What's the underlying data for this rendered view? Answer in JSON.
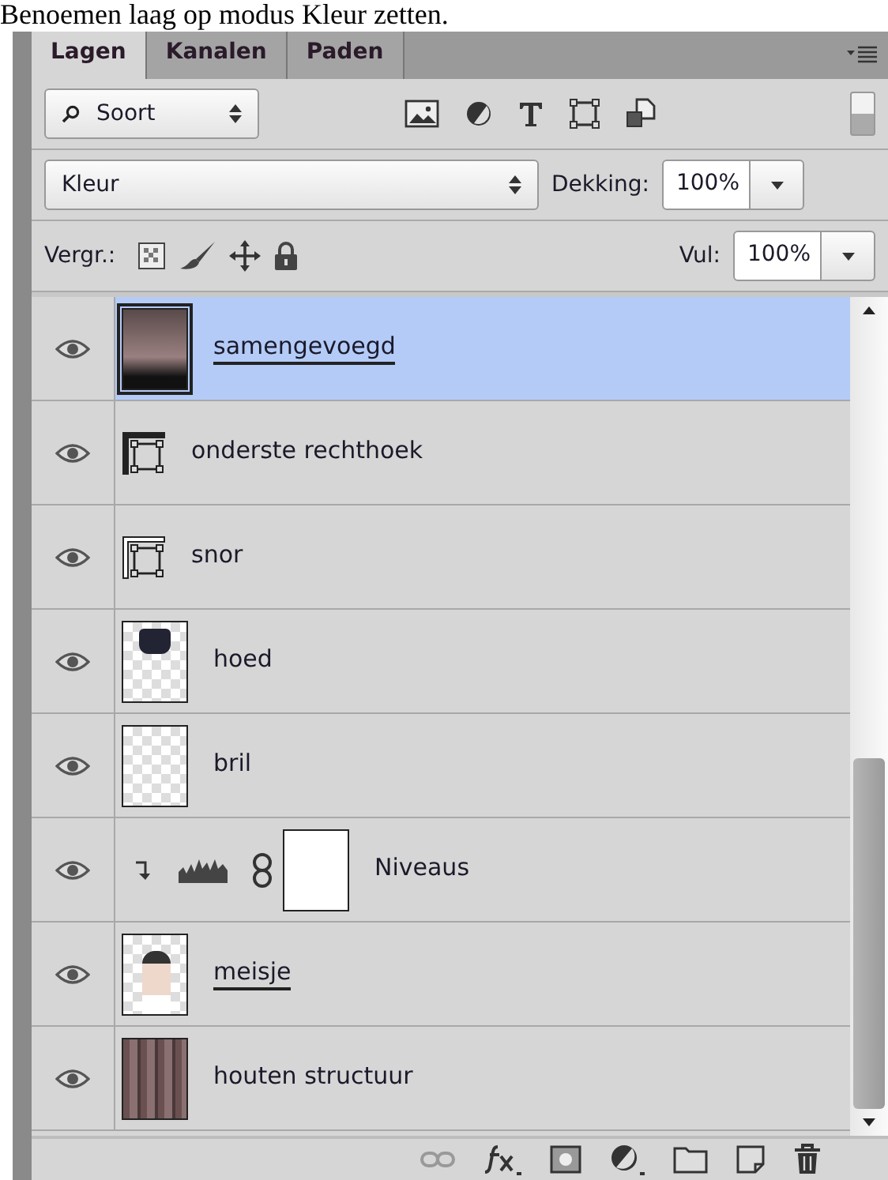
{
  "caption": "Benoemen laag op modus Kleur zetten.",
  "tabs": [
    {
      "label": "Lagen",
      "selected": true
    },
    {
      "label": "Kanalen",
      "selected": false
    },
    {
      "label": "Paden",
      "selected": false
    }
  ],
  "filter": {
    "value": "Soort"
  },
  "blend_mode": {
    "value": "Kleur"
  },
  "opacity": {
    "label": "Dekking:",
    "value": "100%"
  },
  "lock": {
    "label": "Vergr.:"
  },
  "fill": {
    "label": "Vul:",
    "value": "100%"
  },
  "layers": [
    {
      "name": "samengevoegd",
      "kind": "photo",
      "selected": true,
      "underlined": true,
      "visible": true
    },
    {
      "name": "onderste rechthoek",
      "kind": "shape",
      "selected": false,
      "underlined": false,
      "visible": true
    },
    {
      "name": "snor",
      "kind": "shape_outline",
      "selected": false,
      "underlined": false,
      "visible": true
    },
    {
      "name": "hoed",
      "kind": "transparent_hat",
      "selected": false,
      "underlined": false,
      "visible": true
    },
    {
      "name": "bril",
      "kind": "transparent",
      "selected": false,
      "underlined": false,
      "visible": true
    },
    {
      "name": "Niveaus",
      "kind": "adjustment",
      "selected": false,
      "underlined": false,
      "visible": true
    },
    {
      "name": "meisje",
      "kind": "transparent_person",
      "selected": false,
      "underlined": true,
      "visible": true
    },
    {
      "name": "houten structuur",
      "kind": "wood",
      "selected": false,
      "underlined": false,
      "visible": true
    }
  ]
}
